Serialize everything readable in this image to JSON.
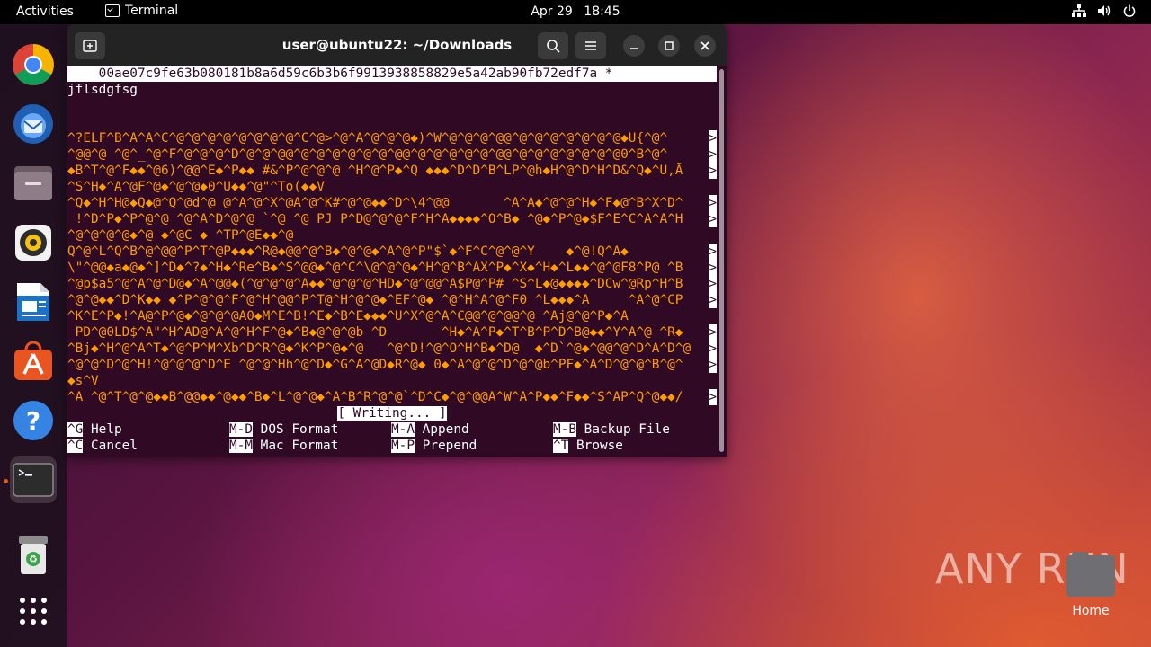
{
  "topbar": {
    "activities": "Activities",
    "app_name": "Terminal",
    "date": "Apr 29",
    "time": "18:45"
  },
  "dock": {
    "items": [
      "chrome",
      "thunderbird",
      "files",
      "rhythmbox",
      "libreoffice-writer",
      "app-center",
      "help",
      "terminal",
      "trash",
      "show-apps"
    ]
  },
  "window": {
    "title": "user@ubuntu22: ~/Downloads"
  },
  "terminal": {
    "header": "    00ae07c9fe63b080181b8a6d59c6b3b6f9913938858829e5a42ab90fb72edf7a *",
    "first_line": "jflsdgfsg",
    "blank1": "",
    "blank2": "",
    "binary_lines": [
      {
        "text": "^?ELF^B^A^A^C^@^@^@^@^@^@^@^@^C^@>^@^A^@^@^@◆)^W^@^@^@^@@^@^@^@^@^@^@^@◆U{^@^",
        "wrap": ">"
      },
      {
        "text": "^@@^@ ^@^_^@^F^@^@^@^D^@^@^@@^@^@^@^@^@^@^@@^@^@^@^@^@^@@^@^@^@^@^@^@^@0^B^@^",
        "wrap": ">"
      },
      {
        "text": "◆B^T^@^F◆◆^@6)^@@^E◆^P◆◆ #&^P^@^@^@ ^H^@^P◆^Q ◆◆◆^D^D^B^LP^@h◆H^@^D^H^D&^Q◆^U,Ã",
        "wrap": ">"
      },
      {
        "text": "^S^H◆^A^@F^@◆^@^@◆0^U◆◆^@\"^To(◆◆V",
        "wrap": ""
      },
      {
        "text": "^Q◆^H^H@◆Q◆@^Q^@d^@ @^A^@^X^@A^@^K#^@^@◆◆^D^\\4^@@       ^A^A◆^@^@^H◆^F◆@^B^X^D^",
        "wrap": ">"
      },
      {
        "text": " !^D^P◆^P^@^@ ^@^A^D^@^@ `^@ ^@ PJ P^D@^@^@^F^H^A◆◆◆◆^O^B◆ ^@◆^P^@◆$F^E^C^A^A^H",
        "wrap": ">"
      },
      {
        "text": "^@^@^@^@◆^@ ◆^@C ◆ ^TP^@E◆◆^@",
        "wrap": ""
      },
      {
        "text": "Q^@^L^Q^B^@^@@^P^T^@P◆◆◆^R@◆@@^@^B◆^@^@◆^A^@^P\"$`◆^F^C^@^@^Y    ◆^@!Q^A◆",
        "wrap": ">"
      },
      {
        "text": "\\\"^@@◆a◆@◆^]^D◆^?◆^H◆^Re^B◆^S^@@◆^@^C^\\@^@^@◆^H^@^B^AX^P◆^X◆^H◆^L◆◆^@^@F8^P@ ^B",
        "wrap": ">"
      },
      {
        "text": "^@p$a5^@^A^@^D@◆^A^@@◆(^@^@^@^A◆◆^@^@^@^HD◆^@^@@^A$P@^P# ^S^L◆@◆◆◆◆^DCw^@Rp^H^B",
        "wrap": ">"
      },
      {
        "text": "^@^@◆◆^D^K◆◆ ◆^P^@^@^F^@^H^@@^P^T@^H^@^@◆^EF^@◆ ^@^H^A^@^F0 ^L◆◆◆^A     ^A^@^CP",
        "wrap": ">"
      },
      {
        "text": "^K^E^P◆!^A@^P^@◆^@^@^@A0◆M^E^B!^E◆^B^E◆◆◆^U^X^@^A^C@@^@^@@^@ ^Aj@^@^P◆^A",
        "wrap": ""
      },
      {
        "text": " PD^@0LD$^A\"^H^AD@^A^@^H^F^@◆^B◆@^@^@b ^D       ^H◆^A^P◆^T^B^P^D^B@◆◆^Y^A^@ ^R◆",
        "wrap": ">"
      },
      {
        "text": "^Bj◆^H^@^A^T◆^@^P^M^Xb^D^R^@◆^K^P^@◆^@   ^@^D!^@^O^H^B◆^D@  ◆^D`^@◆^@@^@^D^A^D^@",
        "wrap": ">"
      },
      {
        "text": "^@^@^D^@^H!^@^@^@^D^E ^@^@^Hh^@^D◆^G^A^@D◆R^@◆ 0◆^A^@^@^D^@^@b^PF◆^A^D^@^@^B^@^",
        "wrap": ">"
      },
      {
        "text": "◆s^V",
        "wrap": ""
      },
      {
        "text": "^A ^@^T^@^@◆◆B^@@◆◆^@◆◆^B◆^L^@^@◆^A^B^R^@^@`^D^C◆^@^@@A^W^A^P◆◆^F◆◆^S^AP^Q^@◆◆/",
        "wrap": ">"
      }
    ],
    "status": "[ Writing... ]",
    "help_rows": [
      [
        {
          "key": "^G",
          "label": " Help"
        },
        {
          "key": "M-D",
          "label": " DOS Format"
        },
        {
          "key": "M-A",
          "label": " Append"
        },
        {
          "key": "M-B",
          "label": " Backup File"
        }
      ],
      [
        {
          "key": "^C",
          "label": " Cancel"
        },
        {
          "key": "M-M",
          "label": " Mac Format"
        },
        {
          "key": "M-P",
          "label": " Prepend"
        },
        {
          "key": "^T",
          "label": " Browse"
        }
      ]
    ]
  },
  "desktop": {
    "home_label": "Home",
    "watermark": "ANY RUN"
  },
  "colors": {
    "terminal_bg": "#300a24",
    "orange_text": "#ff9c00",
    "accent": "#e95420"
  }
}
